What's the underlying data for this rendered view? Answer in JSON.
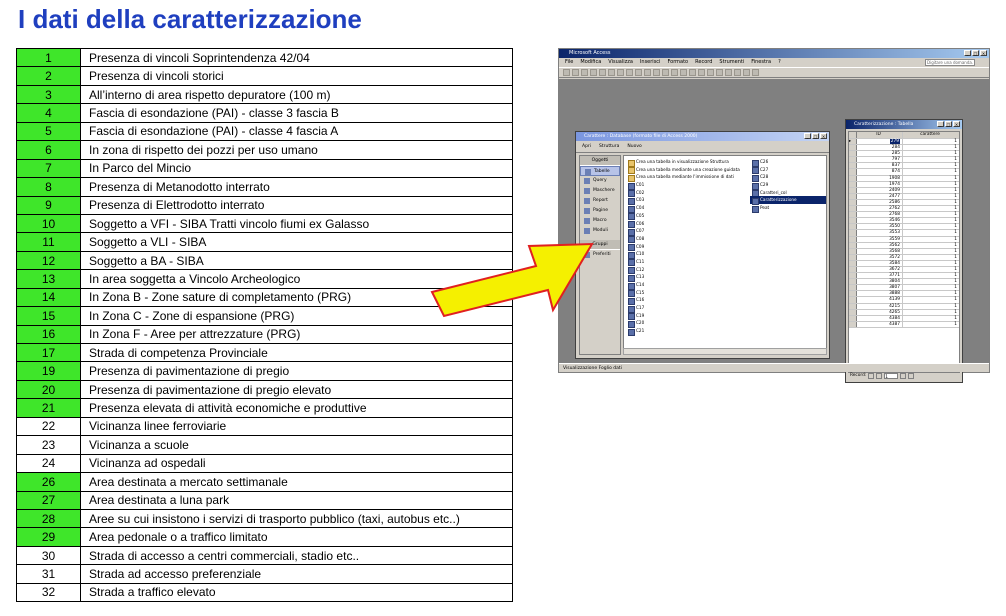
{
  "slide": {
    "title": "I dati della caratterizzazione"
  },
  "colors": {
    "title": "#1f3fbf",
    "green": "#3fe62a",
    "arrow_fill": "#f5f000",
    "arrow_border": "#e02020"
  },
  "rows": [
    {
      "num": "1",
      "text": "Presenza di vincoli Soprintendenza 42/04",
      "green": true
    },
    {
      "num": "2",
      "text": "Presenza di vincoli storici",
      "green": true
    },
    {
      "num": "3",
      "text": "All’interno di area rispetto depuratore (100 m)",
      "green": true
    },
    {
      "num": "4",
      "text": "Fascia di esondazione (PAI) - classe 3 fascia B",
      "green": true
    },
    {
      "num": "5",
      "text": "Fascia di esondazione (PAI) - classe 4 fascia A",
      "green": true
    },
    {
      "num": "6",
      "text": "In zona di rispetto dei pozzi per uso umano",
      "green": true
    },
    {
      "num": "7",
      "text": "In Parco del Mincio",
      "green": true
    },
    {
      "num": "8",
      "text": "Presenza di Metanodotto interrato",
      "green": true
    },
    {
      "num": "9",
      "text": "Presenza di Elettrodotto interrato",
      "green": true
    },
    {
      "num": "10",
      "text": "Soggetto a VFI - SIBA Tratti vincolo fiumi ex Galasso",
      "green": true
    },
    {
      "num": "11",
      "text": "Soggetto a VLI - SIBA",
      "green": true
    },
    {
      "num": "12",
      "text": "Soggetto a BA - SIBA",
      "green": true
    },
    {
      "num": "13",
      "text": "In area soggetta a Vincolo Archeologico",
      "green": true
    },
    {
      "num": "14",
      "text": "In Zona B - Zone sature di completamento (PRG)",
      "green": true
    },
    {
      "num": "15",
      "text": "In Zona C - Zone di espansione (PRG)",
      "green": true
    },
    {
      "num": "16",
      "text": "In Zona F - Aree per attrezzature (PRG)",
      "green": true
    },
    {
      "num": "17",
      "text": "Strada di competenza Provinciale",
      "green": true
    },
    {
      "num": "19",
      "text": "Presenza di pavimentazione di pregio",
      "green": true
    },
    {
      "num": "20",
      "text": "Presenza di pavimentazione di pregio elevato",
      "green": true
    },
    {
      "num": "21",
      "text": "Presenza elevata di attività economiche e produttive",
      "green": true
    },
    {
      "num": "22",
      "text": "Vicinanza linee ferroviarie",
      "green": false
    },
    {
      "num": "23",
      "text": "Vicinanza a scuole",
      "green": false
    },
    {
      "num": "24",
      "text": "Vicinanza ad ospedali",
      "green": false
    },
    {
      "num": "26",
      "text": "Area destinata a mercato settimanale",
      "green": true
    },
    {
      "num": "27",
      "text": "Area destinata a luna park",
      "green": true
    },
    {
      "num": "28",
      "text": "Aree su cui insistono i servizi di trasporto pubblico (taxi, autobus etc..)",
      "green": true
    },
    {
      "num": "29",
      "text": "Area pedonale o a traffico limitato",
      "green": true
    },
    {
      "num": "30",
      "text": "Strada di accesso a centri commerciali, stadio etc..",
      "green": false
    },
    {
      "num": "31",
      "text": "Strada ad accesso preferenziale",
      "green": false
    },
    {
      "num": "32",
      "text": "Strada a traffico elevato",
      "green": false
    }
  ],
  "access": {
    "title": "Microsoft Access",
    "menu": [
      "File",
      "Modifica",
      "Visualizza",
      "Inserisci",
      "Formato",
      "Record",
      "Strumenti",
      "Finestra",
      "?"
    ],
    "ask_placeholder": "Digitare una domanda.",
    "status": "Visualizzazione Foglio dati",
    "db_window": {
      "title": "Carattere : Database (formato file di Access 2000)",
      "toolbar": [
        "Apri",
        "Struttura",
        "Nuovo"
      ],
      "objects_header": "Oggetti",
      "objects": [
        "Tabelle",
        "Query",
        "Maschere",
        "Report",
        "Pagine",
        "Macro",
        "Moduli"
      ],
      "groups_header": "Gruppi",
      "groups": [
        "Preferiti"
      ],
      "col1": [
        "Crea una tabella in visualizzazione Struttura",
        "Crea una tabella mediante una creazione guidata",
        "Crea una tabella mediante l'immissione di dati",
        "C01",
        "C02",
        "C03",
        "C04",
        "C05",
        "C06",
        "C07",
        "C08",
        "C09",
        "C10",
        "C11",
        "C12",
        "C13",
        "C14",
        "C15",
        "C16",
        "C17",
        "C19",
        "C20",
        "C21"
      ],
      "col2": [
        "C26",
        "C27",
        "C28",
        "C29",
        "Caratteri_col",
        "Caratterizzazione",
        "Peat"
      ]
    },
    "table_window": {
      "title": "Caratterizzazione : Tabella",
      "col_id": "ID",
      "col_car": "carattere",
      "rows": [
        {
          "id": "279",
          "c": "1"
        },
        {
          "id": "284",
          "c": "1"
        },
        {
          "id": "285",
          "c": "1"
        },
        {
          "id": "797",
          "c": "1"
        },
        {
          "id": "837",
          "c": "1"
        },
        {
          "id": "874",
          "c": "1"
        },
        {
          "id": "1908",
          "c": "1"
        },
        {
          "id": "1974",
          "c": "1"
        },
        {
          "id": "2409",
          "c": "1"
        },
        {
          "id": "2477",
          "c": "1"
        },
        {
          "id": "2586",
          "c": "1"
        },
        {
          "id": "2762",
          "c": "1"
        },
        {
          "id": "2768",
          "c": "1"
        },
        {
          "id": "3546",
          "c": "1"
        },
        {
          "id": "3550",
          "c": "1"
        },
        {
          "id": "3553",
          "c": "1"
        },
        {
          "id": "3559",
          "c": "1"
        },
        {
          "id": "3562",
          "c": "1"
        },
        {
          "id": "3568",
          "c": "1"
        },
        {
          "id": "3572",
          "c": "1"
        },
        {
          "id": "3584",
          "c": "1"
        },
        {
          "id": "3672",
          "c": "1"
        },
        {
          "id": "3771",
          "c": "1"
        },
        {
          "id": "3804",
          "c": "1"
        },
        {
          "id": "3807",
          "c": "1"
        },
        {
          "id": "3888",
          "c": "1"
        },
        {
          "id": "4139",
          "c": "1"
        },
        {
          "id": "4215",
          "c": "1"
        },
        {
          "id": "4265",
          "c": "1"
        },
        {
          "id": "4384",
          "c": "1"
        },
        {
          "id": "4387",
          "c": "1"
        }
      ],
      "nav_label": "Record:",
      "nav_value": "1"
    }
  }
}
